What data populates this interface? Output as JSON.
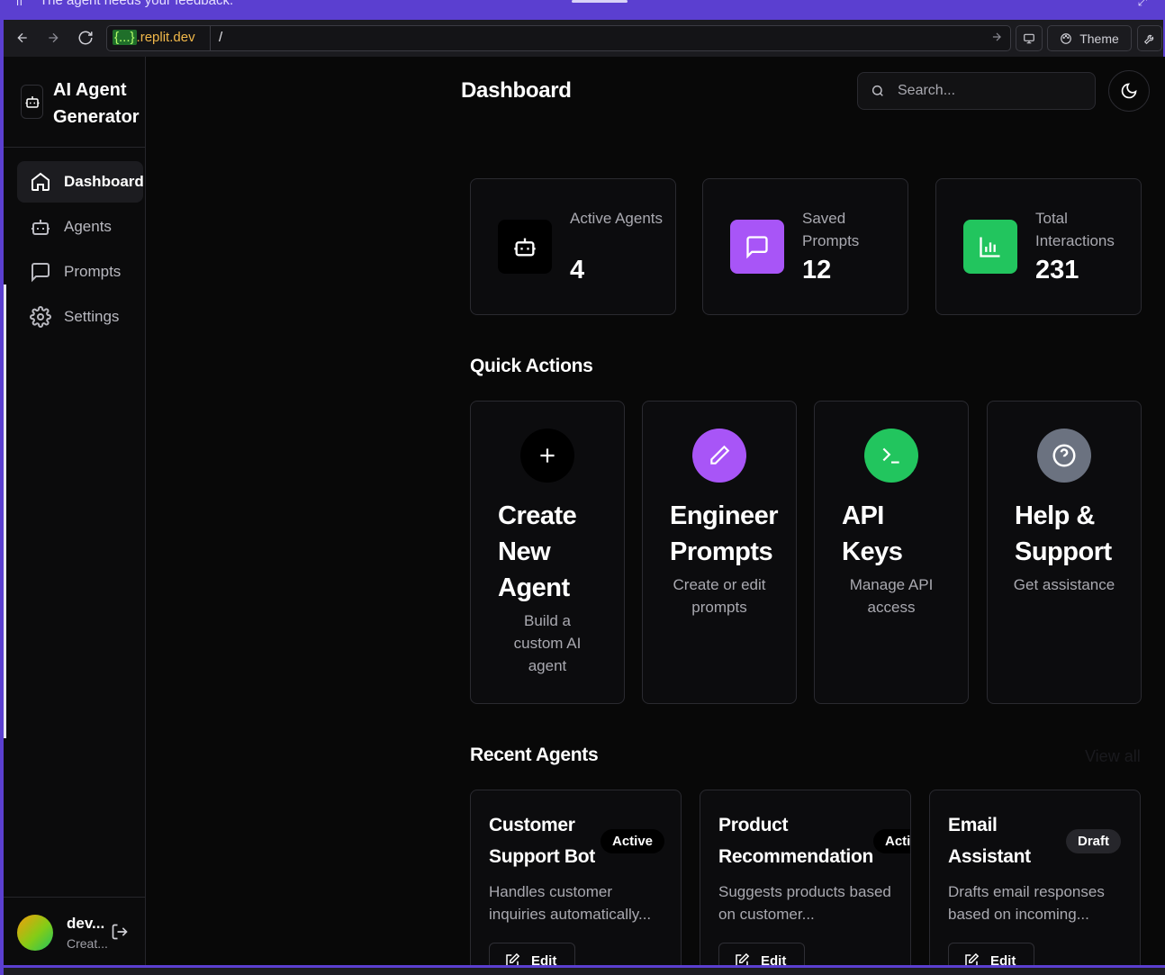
{
  "banner": {
    "text": "The agent needs your feedback."
  },
  "browser": {
    "url_domain_curly": "{...}",
    "url_domain_rest": ".replit.dev",
    "url_path": "/",
    "theme_label": "Theme"
  },
  "sidebar": {
    "brand": "AI Agent Generator",
    "items": [
      {
        "label": "Dashboard",
        "icon": "home-icon",
        "active": true
      },
      {
        "label": "Agents",
        "icon": "bot-icon",
        "active": false
      },
      {
        "label": "Prompts",
        "icon": "message-square-icon",
        "active": false
      },
      {
        "label": "Settings",
        "icon": "gear-icon",
        "active": false
      }
    ],
    "user": {
      "name": "dev...",
      "subtitle": "Creat..."
    }
  },
  "header": {
    "title": "Dashboard",
    "search_placeholder": "Search..."
  },
  "stats": [
    {
      "label": "Active Agents",
      "value": "4",
      "icon": "bot-icon",
      "color": "#000000"
    },
    {
      "label": "Saved Prompts",
      "value": "12",
      "icon": "message-square-icon",
      "color": "#a855f7"
    },
    {
      "label": "Total Interactions",
      "value": "231",
      "icon": "bar-chart-icon",
      "color": "#22c55e"
    }
  ],
  "quick_actions": {
    "title": "Quick Actions",
    "items": [
      {
        "title": "Create New Agent",
        "desc": "Build a custom AI agent",
        "icon": "plus-icon",
        "color": "#000000"
      },
      {
        "title": "Engineer Prompts",
        "desc": "Create or edit prompts",
        "icon": "pencil-icon",
        "color": "#a855f7"
      },
      {
        "title": "API Keys",
        "desc": "Manage API access",
        "icon": "terminal-icon",
        "color": "#22c55e"
      },
      {
        "title": "Help & Support",
        "desc": "Get assistance",
        "icon": "help-circle-icon",
        "color": "#6b7280"
      }
    ]
  },
  "recent_agents": {
    "title": "Recent Agents",
    "view_all": "View all",
    "items": [
      {
        "name": "Customer Support Bot",
        "status": "Active",
        "desc": "Handles customer inquiries automatically...",
        "edit": "Edit"
      },
      {
        "name": "Product Recommendation",
        "status": "Active",
        "desc": "Suggests products based on customer...",
        "edit": "Edit"
      },
      {
        "name": "Email Assistant",
        "status": "Draft",
        "desc": "Drafts email responses based on incoming...",
        "edit": "Edit"
      }
    ]
  }
}
